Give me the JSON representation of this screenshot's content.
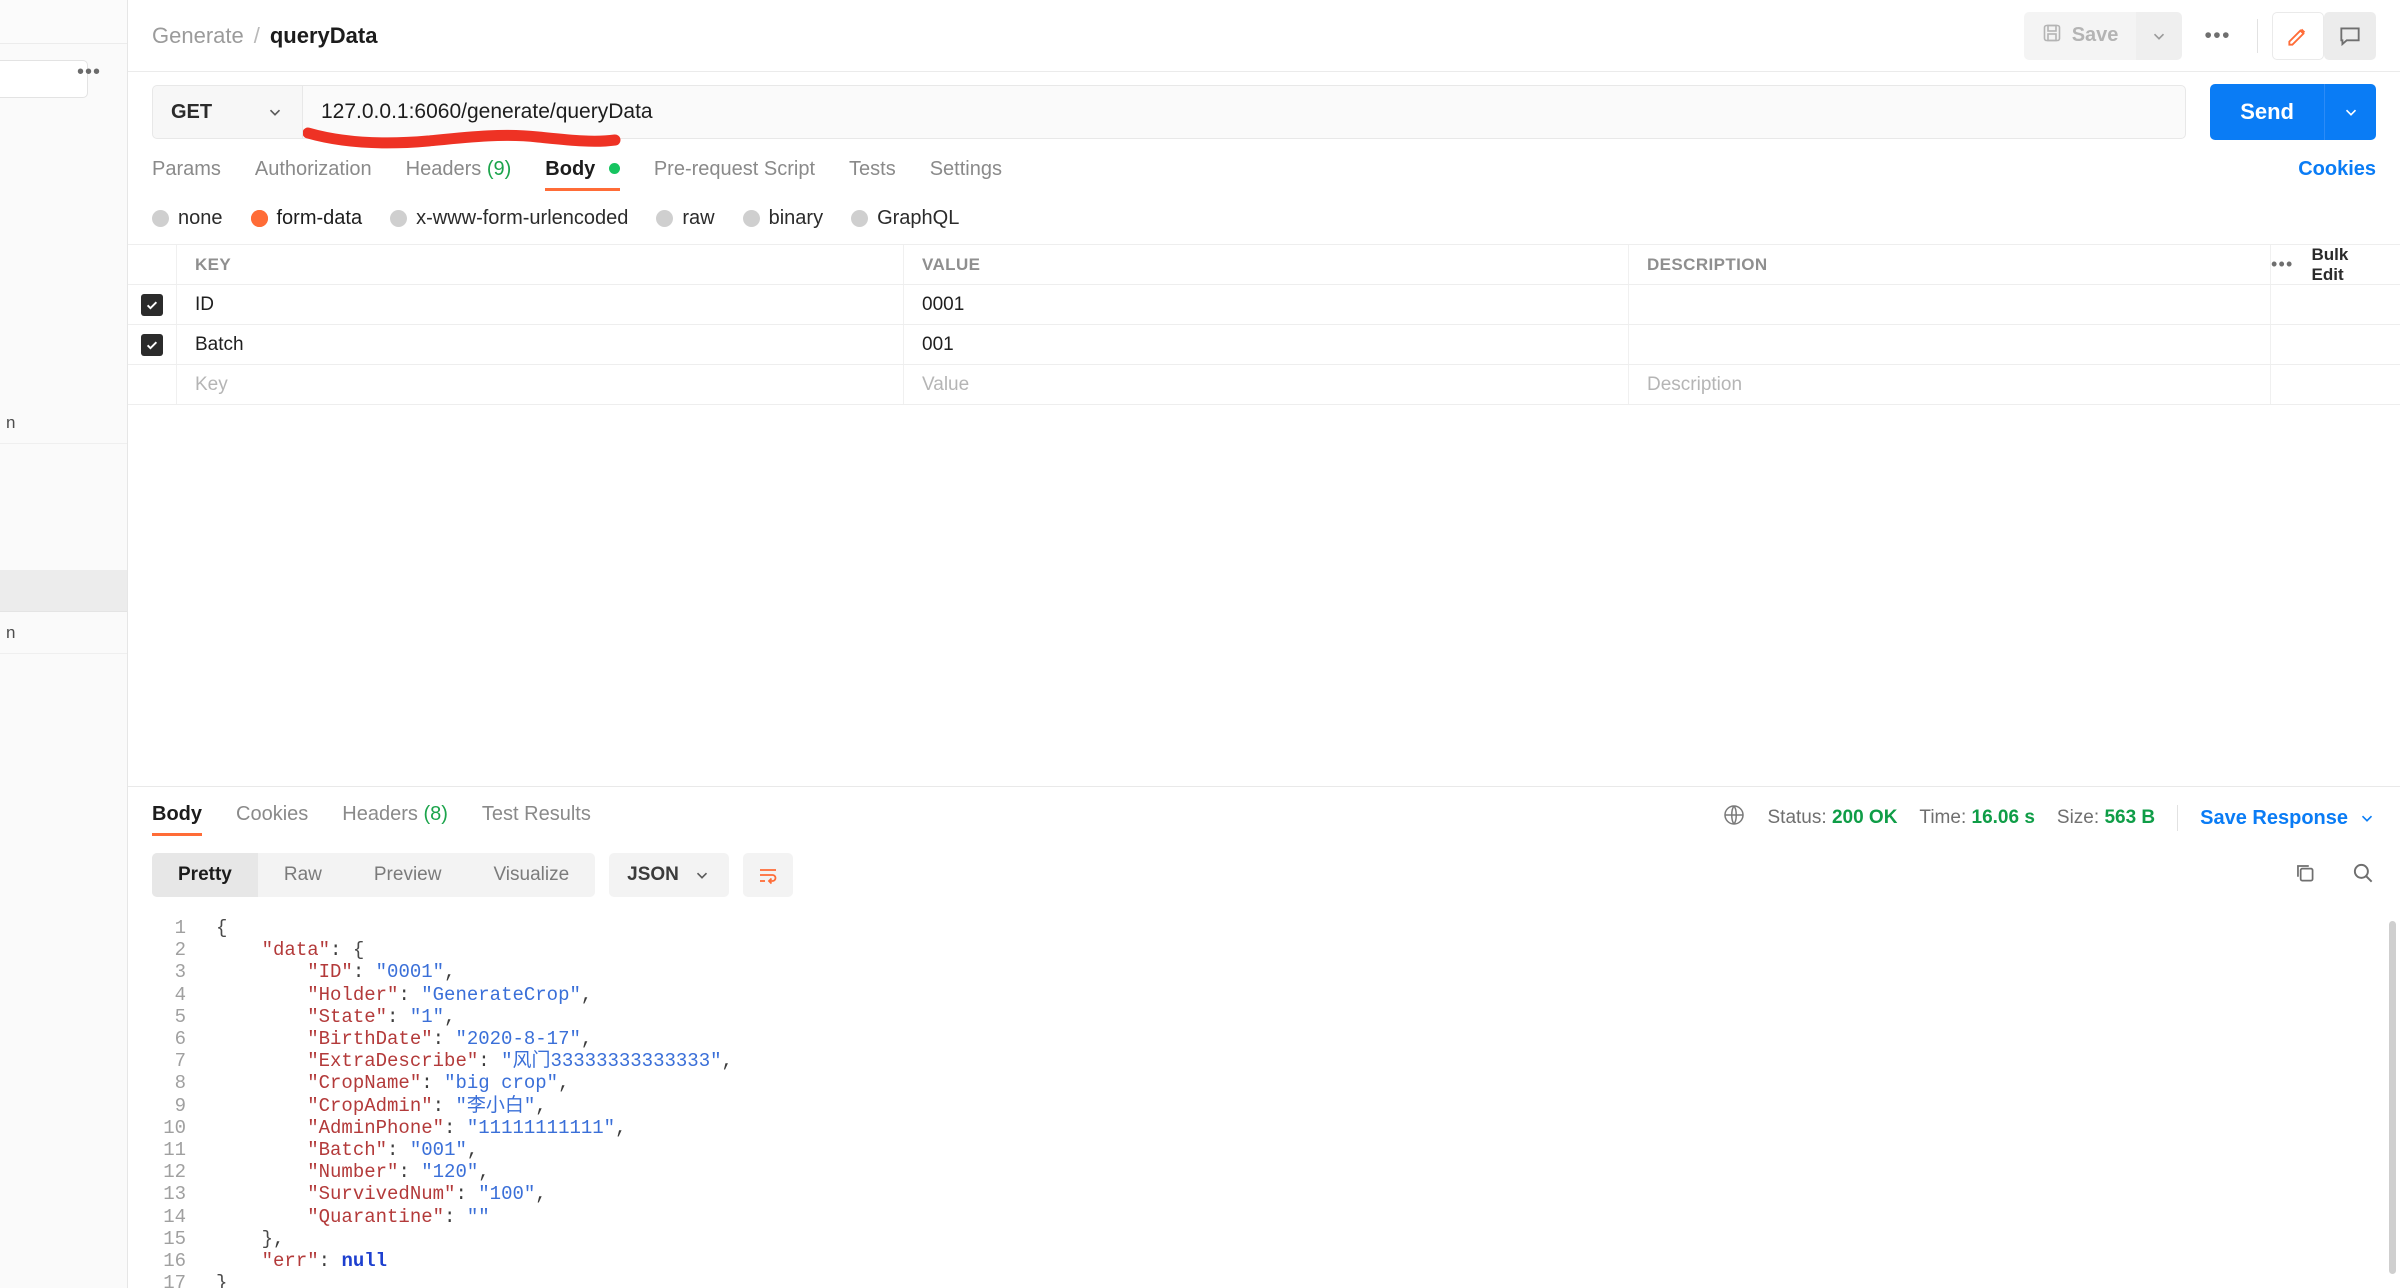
{
  "sidebar": {
    "search_placeholder": "",
    "dots_icon": "ellipsis-icon",
    "fragment_top": "n",
    "fragment_bottom": "n"
  },
  "header": {
    "breadcrumb_parent": "Generate",
    "breadcrumb_sep": "/",
    "breadcrumb_current": "queryData",
    "save_label": "Save",
    "save_icon": "floppy-disk-icon",
    "caret_icon": "chevron-down-icon",
    "more_icon": "ellipsis-icon",
    "edit_icon": "pencil-icon",
    "comment_icon": "comment-icon"
  },
  "request": {
    "method": "GET",
    "method_caret": "chevron-down-icon",
    "url": "127.0.0.1:6060/generate/queryData",
    "send_label": "Send",
    "send_caret": "chevron-down-icon",
    "annotation_color": "#ee3224",
    "tabs": [
      {
        "label": "Params",
        "active": false
      },
      {
        "label": "Authorization",
        "active": false
      },
      {
        "label": "Headers",
        "count": "(9)",
        "active": false
      },
      {
        "label": "Body",
        "active": true,
        "dot": true
      },
      {
        "label": "Pre-request Script",
        "active": false
      },
      {
        "label": "Tests",
        "active": false
      },
      {
        "label": "Settings",
        "active": false
      }
    ],
    "cookies_link": "Cookies",
    "body_types": [
      {
        "label": "none",
        "selected": false
      },
      {
        "label": "form-data",
        "selected": true
      },
      {
        "label": "x-www-form-urlencoded",
        "selected": false
      },
      {
        "label": "raw",
        "selected": false
      },
      {
        "label": "binary",
        "selected": false
      },
      {
        "label": "GraphQL",
        "selected": false
      }
    ],
    "table": {
      "headers": {
        "key": "KEY",
        "value": "VALUE",
        "description": "DESCRIPTION"
      },
      "bulk_edit": "Bulk Edit",
      "more_icon": "ellipsis-icon",
      "rows": [
        {
          "checked": true,
          "key": "ID",
          "value": "0001",
          "description": ""
        },
        {
          "checked": true,
          "key": "Batch",
          "value": "001",
          "description": ""
        }
      ],
      "placeholder_row": {
        "key": "Key",
        "value": "Value",
        "description": "Description"
      }
    }
  },
  "response": {
    "tabs": [
      {
        "label": "Body",
        "active": true
      },
      {
        "label": "Cookies",
        "active": false
      },
      {
        "label": "Headers",
        "count": "(8)",
        "active": false
      },
      {
        "label": "Test Results",
        "active": false
      }
    ],
    "globe_icon": "globe-icon",
    "status_label": "Status:",
    "status_value": "200 OK",
    "time_label": "Time:",
    "time_value": "16.06 s",
    "size_label": "Size:",
    "size_value": "563 B",
    "save_response": "Save Response",
    "save_response_caret": "chevron-down-icon",
    "view_modes": [
      {
        "label": "Pretty",
        "active": true
      },
      {
        "label": "Raw",
        "active": false
      },
      {
        "label": "Preview",
        "active": false
      },
      {
        "label": "Visualize",
        "active": false
      }
    ],
    "format": "JSON",
    "format_caret": "chevron-down-icon",
    "wrap_icon": "text-wrap-icon",
    "copy_icon": "copy-icon",
    "search_icon": "search-icon",
    "body_lines": [
      {
        "n": 1,
        "tokens": [
          {
            "t": "brace",
            "v": "{"
          }
        ]
      },
      {
        "n": 2,
        "tokens": [
          {
            "t": "sp",
            "v": "    "
          },
          {
            "t": "k",
            "v": "\"data\""
          },
          {
            "t": "p",
            "v": ": "
          },
          {
            "t": "brace",
            "v": "{"
          }
        ]
      },
      {
        "n": 3,
        "tokens": [
          {
            "t": "sp",
            "v": "        "
          },
          {
            "t": "k",
            "v": "\"ID\""
          },
          {
            "t": "p",
            "v": ": "
          },
          {
            "t": "s",
            "v": "\"0001\""
          },
          {
            "t": "p",
            "v": ","
          }
        ]
      },
      {
        "n": 4,
        "tokens": [
          {
            "t": "sp",
            "v": "        "
          },
          {
            "t": "k",
            "v": "\"Holder\""
          },
          {
            "t": "p",
            "v": ": "
          },
          {
            "t": "s",
            "v": "\"GenerateCrop\""
          },
          {
            "t": "p",
            "v": ","
          }
        ]
      },
      {
        "n": 5,
        "tokens": [
          {
            "t": "sp",
            "v": "        "
          },
          {
            "t": "k",
            "v": "\"State\""
          },
          {
            "t": "p",
            "v": ": "
          },
          {
            "t": "s",
            "v": "\"1\""
          },
          {
            "t": "p",
            "v": ","
          }
        ]
      },
      {
        "n": 6,
        "tokens": [
          {
            "t": "sp",
            "v": "        "
          },
          {
            "t": "k",
            "v": "\"BirthDate\""
          },
          {
            "t": "p",
            "v": ": "
          },
          {
            "t": "s",
            "v": "\"2020-8-17\""
          },
          {
            "t": "p",
            "v": ","
          }
        ]
      },
      {
        "n": 7,
        "tokens": [
          {
            "t": "sp",
            "v": "        "
          },
          {
            "t": "k",
            "v": "\"ExtraDescribe\""
          },
          {
            "t": "p",
            "v": ": "
          },
          {
            "t": "s",
            "v": "\"风门33333333333333\""
          },
          {
            "t": "p",
            "v": ","
          }
        ]
      },
      {
        "n": 8,
        "tokens": [
          {
            "t": "sp",
            "v": "        "
          },
          {
            "t": "k",
            "v": "\"CropName\""
          },
          {
            "t": "p",
            "v": ": "
          },
          {
            "t": "s",
            "v": "\"big crop\""
          },
          {
            "t": "p",
            "v": ","
          }
        ]
      },
      {
        "n": 9,
        "tokens": [
          {
            "t": "sp",
            "v": "        "
          },
          {
            "t": "k",
            "v": "\"CropAdmin\""
          },
          {
            "t": "p",
            "v": ": "
          },
          {
            "t": "s",
            "v": "\"李小白\""
          },
          {
            "t": "p",
            "v": ","
          }
        ]
      },
      {
        "n": 10,
        "tokens": [
          {
            "t": "sp",
            "v": "        "
          },
          {
            "t": "k",
            "v": "\"AdminPhone\""
          },
          {
            "t": "p",
            "v": ": "
          },
          {
            "t": "s",
            "v": "\"11111111111\""
          },
          {
            "t": "p",
            "v": ","
          }
        ]
      },
      {
        "n": 11,
        "tokens": [
          {
            "t": "sp",
            "v": "        "
          },
          {
            "t": "k",
            "v": "\"Batch\""
          },
          {
            "t": "p",
            "v": ": "
          },
          {
            "t": "s",
            "v": "\"001\""
          },
          {
            "t": "p",
            "v": ","
          }
        ]
      },
      {
        "n": 12,
        "tokens": [
          {
            "t": "sp",
            "v": "        "
          },
          {
            "t": "k",
            "v": "\"Number\""
          },
          {
            "t": "p",
            "v": ": "
          },
          {
            "t": "s",
            "v": "\"120\""
          },
          {
            "t": "p",
            "v": ","
          }
        ]
      },
      {
        "n": 13,
        "tokens": [
          {
            "t": "sp",
            "v": "        "
          },
          {
            "t": "k",
            "v": "\"SurvivedNum\""
          },
          {
            "t": "p",
            "v": ": "
          },
          {
            "t": "s",
            "v": "\"100\""
          },
          {
            "t": "p",
            "v": ","
          }
        ]
      },
      {
        "n": 14,
        "tokens": [
          {
            "t": "sp",
            "v": "        "
          },
          {
            "t": "k",
            "v": "\"Quarantine\""
          },
          {
            "t": "p",
            "v": ": "
          },
          {
            "t": "s",
            "v": "\"\""
          }
        ]
      },
      {
        "n": 15,
        "tokens": [
          {
            "t": "sp",
            "v": "    "
          },
          {
            "t": "brace",
            "v": "}"
          },
          {
            "t": "p",
            "v": ","
          }
        ]
      },
      {
        "n": 16,
        "tokens": [
          {
            "t": "sp",
            "v": "    "
          },
          {
            "t": "k",
            "v": "\"err\""
          },
          {
            "t": "p",
            "v": ": "
          },
          {
            "t": "n",
            "v": "null"
          }
        ]
      },
      {
        "n": 17,
        "tokens": [
          {
            "t": "brace",
            "v": "}"
          }
        ]
      }
    ]
  }
}
